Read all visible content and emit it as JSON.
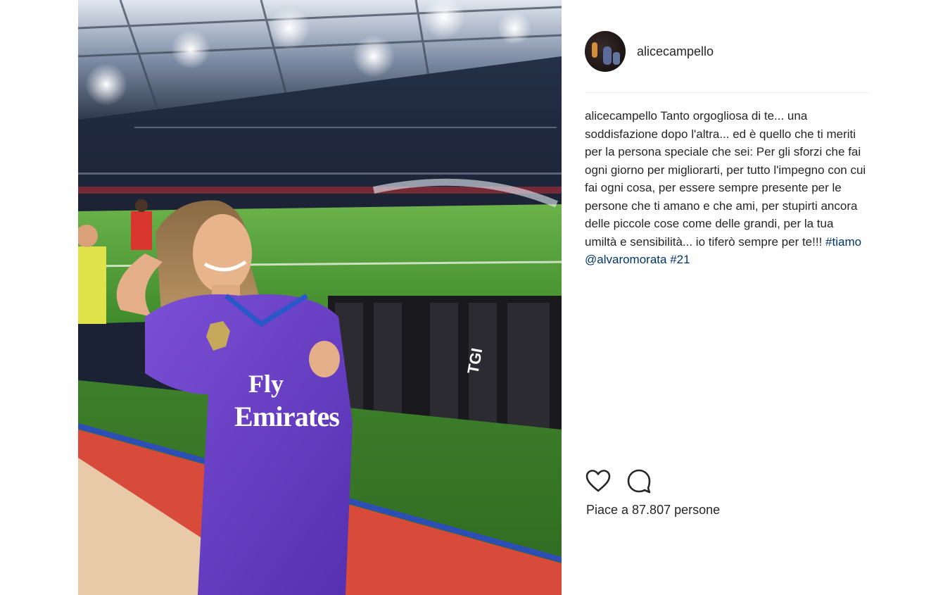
{
  "post": {
    "username": "alicecampello",
    "caption_user": "alicecampello",
    "caption_text": "Tanto orgogliosa di te... una soddisfazione dopo l'altra... ed è quello che ti meriti per la persona speciale che sei: Per gli sforzi che fai ogni giorno per migliorarti, per tutto l'impegno con cui fai ogni cosa, per essere sempre presente per le persone che ti amano e che ami, per stupirti ancora delle piccole cose come delle grandi, per la tua umiltà e sensibilità... io tiferò sempre per te!!!",
    "hashtags": [
      "#tiamo",
      "@alvaromorata",
      "#21"
    ],
    "likes_text": "Piace a 87.807 persone"
  },
  "photo": {
    "jersey_text_line1": "Fly",
    "jersey_text_line2": "Emirates",
    "board_text": "TGI"
  },
  "icons": {
    "like": "heart-icon",
    "comment": "comment-bubble-icon"
  },
  "colors": {
    "text": "#262626",
    "link": "#003569",
    "divider": "#efefef",
    "pitch": "#4f9a3a",
    "jersey": "#6a3fc6"
  }
}
